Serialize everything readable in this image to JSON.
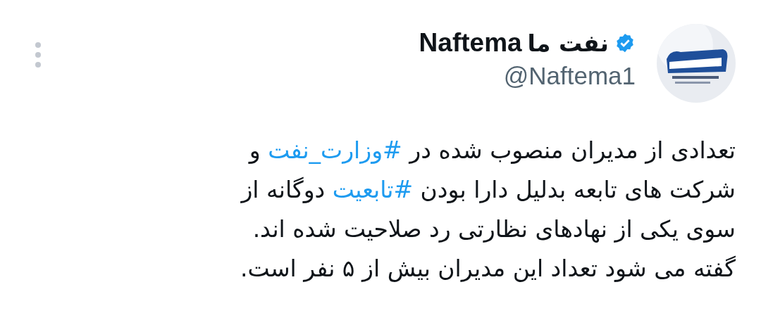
{
  "author": {
    "name_fa": "نفت ما",
    "name_en": "Naftema",
    "verified": true,
    "handle": "@Naftema1"
  },
  "tweet": {
    "lines": [
      [
        {
          "kind": "text",
          "text": "تعدادی از مدیران منصوب شده در "
        },
        {
          "kind": "hashtag",
          "text": "#وزارت_نفت"
        },
        {
          "kind": "text",
          "text": " و"
        }
      ],
      [
        {
          "kind": "text",
          "text": "شرکت های تابعه بدلیل دارا بودن "
        },
        {
          "kind": "hashtag",
          "text": "#تابعیت"
        },
        {
          "kind": "text",
          "text": " دوگانه از"
        }
      ],
      [
        {
          "kind": "text",
          "text": "سوی یکی از نهادهای نظارتی رد صلاحیت شده اند."
        }
      ],
      [
        {
          "kind": "text",
          "text": "گفته می شود تعداد این مدیران بیش از ۵ نفر است."
        }
      ]
    ]
  }
}
